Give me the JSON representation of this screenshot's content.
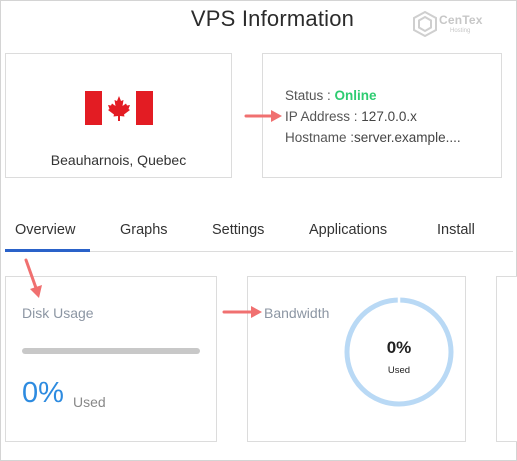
{
  "page": {
    "title": "VPS Information"
  },
  "logo": {
    "name": "CenTex",
    "tagline": "Hosting"
  },
  "location": {
    "name": "Beauharnois, Quebec"
  },
  "vps": {
    "status_label": "Status : ",
    "status_value": "Online",
    "ip_label": "IP Address : ",
    "ip_value": "127.0.0.x",
    "hostname_label": "Hostname :",
    "hostname_value": "server.example...."
  },
  "tabs": [
    "Overview",
    "Graphs",
    "Settings",
    "Applications",
    "Install"
  ],
  "active_tab": "Overview",
  "disk": {
    "label": "Disk Usage",
    "value": "0%",
    "used_label": "Used",
    "usage_fraction": 0
  },
  "bandwidth": {
    "label": "Bandwidth",
    "value": "0%",
    "used_label": "Used",
    "usage_fraction": 0
  },
  "colors": {
    "accent": "#2a62c9",
    "online": "#2ecc71",
    "disk_value": "#2d8be0",
    "annotation_arrow": "#f07070",
    "donut_ring": "#b9d9f5",
    "flag_red": "#e31c23"
  }
}
